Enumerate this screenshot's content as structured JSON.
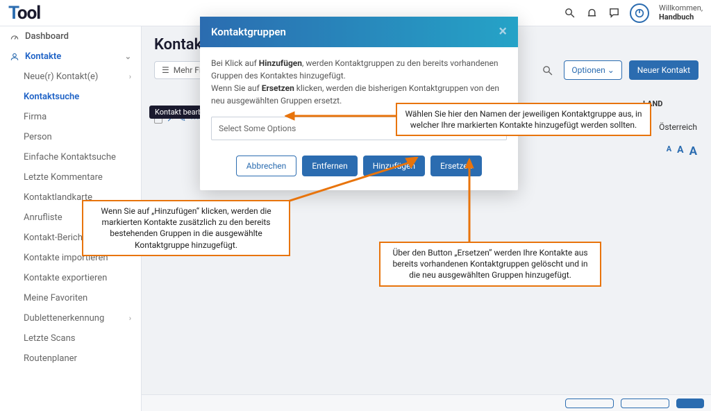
{
  "header": {
    "logo_prefix": "T",
    "logo_rest": "ool",
    "welcome_label": "Willkommen,",
    "welcome_name": "Handbuch"
  },
  "sidebar": {
    "dashboard": "Dashboard",
    "contacts": "Kontakte",
    "items": [
      "Neue(r) Kontakt(e)",
      "Kontaktsuche",
      "Firma",
      "Person",
      "Einfache Kontaktsuche",
      "Letzte Kommentare",
      "Kontaktlandkarte",
      "Anrufliste",
      "Kontakt-Berichte",
      "Kontakte importieren",
      "Kontakte exportieren",
      "Meine Favoriten",
      "Dublettenerkennung",
      "Letzte Scans",
      "Routenplaner"
    ]
  },
  "main": {
    "title": "Kontaktsuche",
    "filter_label": "Mehr Filter",
    "options_label": "Optionen",
    "new_contact_label": "Neuer Kontakt",
    "tooltip": "Kontakt bearbeiten",
    "table": {
      "land_header": "LAND",
      "land_value": "Österreich"
    }
  },
  "modal": {
    "title": "Kontaktgruppen",
    "body_line1_a": "Bei Klick auf ",
    "body_line1_b": "Hinzufügen",
    "body_line1_c": ", werden Kontaktgruppen zu den bereits vorhandenen Gruppen des Kontaktes hinzugefügt.",
    "body_line2_a": "Wenn Sie auf ",
    "body_line2_b": "Ersetzen",
    "body_line2_c": " klicken, werden die bisherigen Kontaktgruppen von den neu ausgewählten Gruppen ersetzt.",
    "select_placeholder": "Select Some Options",
    "btn_cancel": "Abbrechen",
    "btn_remove": "Entfernen",
    "btn_add": "Hinzufügen",
    "btn_replace": "Ersetzen"
  },
  "callouts": {
    "select_hint": "Wählen Sie hier den Namen der jeweiligen Kontaktgruppe aus, in welcher Ihre markierten Kontakte hinzugefügt werden sollten.",
    "add_hint": "Wenn Sie auf „Hinzufügen“ klicken, werden die markierten Kontakte zusätzlich zu den bereits bestehenden Gruppen in die ausgewählte Kontaktgruppe hinzugefügt.",
    "replace_hint": "Über den Button „Ersetzen“ werden Ihre Kontakte aus bereits vorhandenen Kontaktgruppen gelöscht und in die neu ausgewählten Gruppen hinzugefügt."
  }
}
